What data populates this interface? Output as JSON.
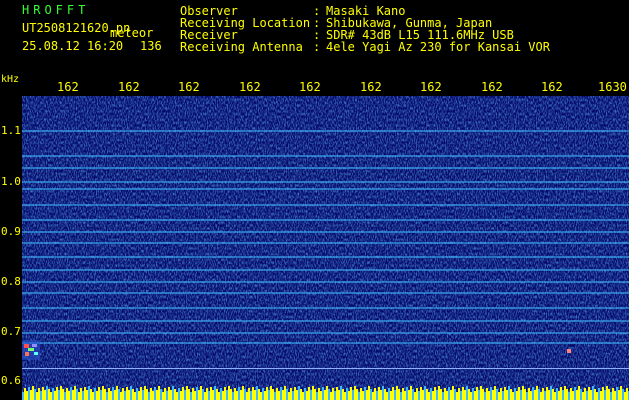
{
  "header": {
    "brand": "HROFFT",
    "filename": "UT2508121620.pn",
    "mode": "meteor",
    "datetime": "25.08.12 16:20",
    "count": "136",
    "fields": [
      {
        "label": "Observer",
        "value": "Masaki Kano"
      },
      {
        "label": "Receiving Location",
        "value": "Shibukawa, Gunma, Japan"
      },
      {
        "label": "Receiver",
        "value": "SDR# 43dB L15 111.6MHz USB"
      },
      {
        "label": "Receiving Antenna",
        "value": "4ele Yagi Az 230 for Kansai VOR"
      }
    ],
    "separator": ":"
  },
  "axis": {
    "unit": "kHz",
    "y_labels": [
      "1.1",
      "1.0",
      "0.9",
      "0.8",
      "0.7",
      "0.6"
    ],
    "x_labels": [
      "162",
      "162",
      "162",
      "162",
      "162",
      "162",
      "162",
      "162",
      "162",
      "1630"
    ]
  },
  "colors": {
    "background": "#000000",
    "text": "#ffff00",
    "brand": "#33ff33",
    "noise": "#050a7a",
    "line": "#3fb8ff",
    "baseline": "#ffff00"
  }
}
